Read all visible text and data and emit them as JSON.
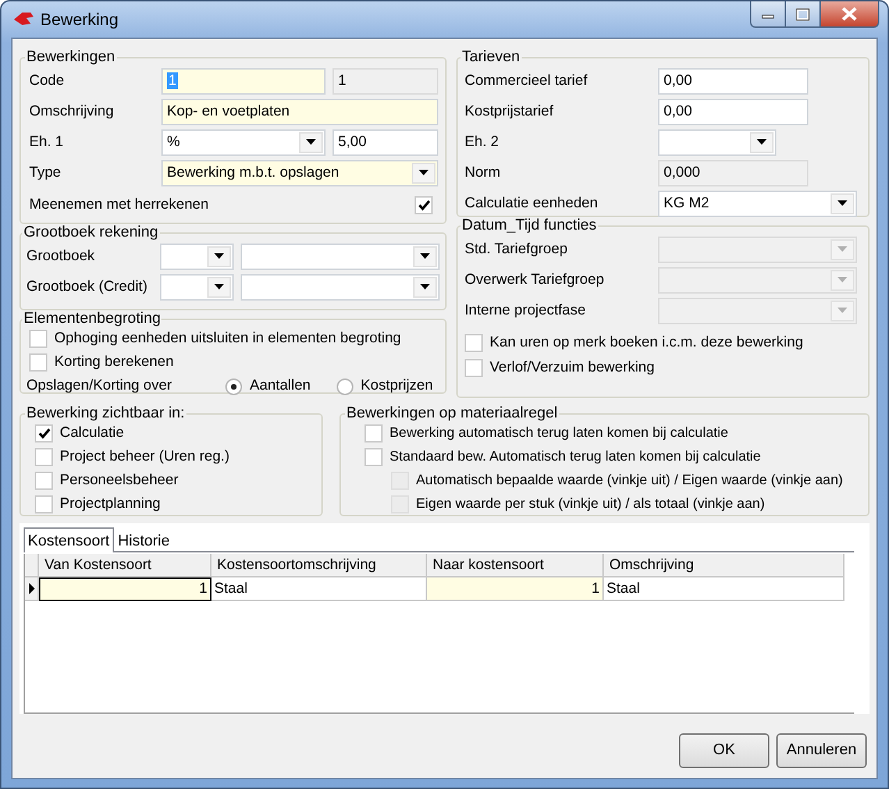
{
  "window": {
    "title": "Bewerking"
  },
  "bewerkingen": {
    "title": "Bewerkingen",
    "rows": [
      {
        "label": "Code",
        "fields": [
          {
            "kind": "text",
            "value": "1",
            "highlighted": true,
            "text_selected": true
          },
          {
            "kind": "text",
            "value": "1",
            "readonly": true
          }
        ]
      },
      {
        "label": "Omschrijving",
        "fields": [
          {
            "kind": "text",
            "value": "Kop- en voetplaten",
            "highlighted": true
          }
        ]
      },
      {
        "label": "Eh. 1",
        "fields": [
          {
            "kind": "combo",
            "value": "%"
          },
          {
            "kind": "text",
            "value": "5,00"
          }
        ]
      },
      {
        "label": "Type",
        "fields": [
          {
            "kind": "combo",
            "value": "Bewerking m.b.t. opslagen",
            "highlighted": true
          }
        ]
      }
    ],
    "checkbox": {
      "label": "Meenemen met herrekenen",
      "checked": true
    }
  },
  "grootboek": {
    "title": "Grootboek rekening",
    "rows": [
      {
        "label": "Grootboek",
        "fields": [
          {
            "kind": "combo"
          },
          {
            "kind": "combo"
          }
        ]
      },
      {
        "label": "Grootboek (Credit)",
        "fields": [
          {
            "kind": "combo"
          },
          {
            "kind": "combo"
          }
        ]
      }
    ]
  },
  "elementenbegroting": {
    "title": "Elementenbegroting",
    "checkboxes": [
      {
        "label": "Ophoging eenheden uitsluiten in elementen begroting",
        "checked": false
      },
      {
        "label": "Korting berekenen",
        "checked": false
      }
    ],
    "radio_group": {
      "label": "Opslagen/Korting over",
      "options": [
        {
          "label": "Aantallen",
          "selected": true
        },
        {
          "label": "Kostprijzen",
          "selected": false
        }
      ]
    }
  },
  "tarieven": {
    "title": "Tarieven",
    "rows": [
      {
        "label": "Commercieel tarief",
        "fields": [
          {
            "kind": "text",
            "value": "0,00"
          }
        ]
      },
      {
        "label": "Kostprijstarief",
        "fields": [
          {
            "kind": "text",
            "value": "0,00"
          }
        ]
      },
      {
        "label": "Eh. 2",
        "fields": [
          {
            "kind": "combo"
          }
        ]
      },
      {
        "label": "Norm",
        "fields": [
          {
            "kind": "text",
            "value": "0,000",
            "readonly": true
          }
        ]
      },
      {
        "label": "Calculatie eenheden",
        "fields": [
          {
            "kind": "combo",
            "value": "KG M2"
          }
        ]
      }
    ]
  },
  "datum_tijd": {
    "title": "Datum_Tijd functies",
    "rows": [
      {
        "label": "Std. Tariefgroep",
        "fields": [
          {
            "kind": "combo",
            "disabled": true
          }
        ]
      },
      {
        "label": "Overwerk Tariefgroep",
        "fields": [
          {
            "kind": "combo",
            "disabled": true
          }
        ]
      },
      {
        "label": "Interne projectfase",
        "fields": [
          {
            "kind": "combo",
            "disabled": true
          }
        ]
      }
    ],
    "checkboxes": [
      {
        "label": "Kan uren op merk boeken i.c.m. deze bewerking",
        "checked": false
      },
      {
        "label": "Verlof/Verzuim bewerking",
        "checked": false
      }
    ]
  },
  "zichtbaar": {
    "title": "Bewerking zichtbaar in:",
    "checkboxes": [
      {
        "label": "Calculatie",
        "checked": true
      },
      {
        "label": "Project beheer (Uren reg.)",
        "checked": false
      },
      {
        "label": "Personeelsbeheer",
        "checked": false
      },
      {
        "label": "Projectplanning",
        "checked": false
      }
    ]
  },
  "materiaalregel": {
    "title": "Bewerkingen op materiaalregel",
    "checkboxes": [
      {
        "label": "Bewerking automatisch terug laten komen bij calculatie",
        "checked": false
      },
      {
        "label": "Standaard bew. Automatisch terug laten komen bij calculatie",
        "checked": false,
        "children": [
          {
            "label": "Automatisch bepaalde waarde (vinkje uit) / Eigen waarde (vinkje aan)",
            "checked": false,
            "disabled": true
          },
          {
            "label": "Eigen waarde per stuk (vinkje uit) / als totaal (vinkje aan)",
            "checked": false,
            "disabled": true
          }
        ]
      }
    ]
  },
  "tabs": [
    {
      "label": "Kostensoort",
      "selected": true
    },
    {
      "label": "Historie",
      "selected": false
    }
  ],
  "grid": {
    "columns": [
      {
        "label": "Van Kostensoort",
        "highlighted": true,
        "numeric": true
      },
      {
        "label": "Kostensoortomschrijving",
        "highlighted": false,
        "numeric": false
      },
      {
        "label": "Naar kostensoort",
        "highlighted": true,
        "numeric": true
      },
      {
        "label": "Omschrijving",
        "highlighted": false,
        "numeric": false
      }
    ],
    "rows": [
      {
        "selected": true,
        "cells": [
          "1",
          "Staal",
          "1",
          "Staal"
        ]
      }
    ]
  },
  "buttons": [
    {
      "label": "OK"
    },
    {
      "label": "Annuleren"
    }
  ]
}
